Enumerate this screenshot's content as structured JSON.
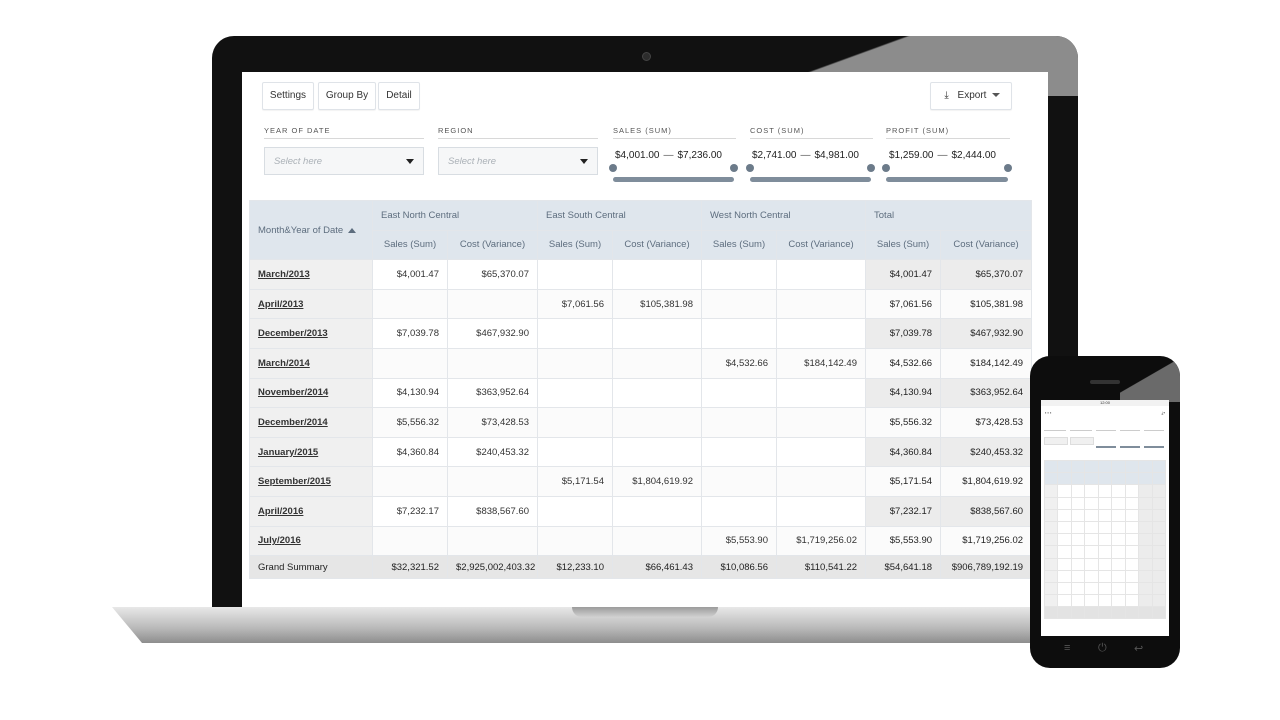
{
  "toolbar": {
    "settings": "Settings",
    "group_by": "Group By",
    "detail": "Detail",
    "export": "Export"
  },
  "filters": {
    "year": {
      "label": "YEAR OF DATE",
      "placeholder": "Select here"
    },
    "region": {
      "label": "REGION",
      "placeholder": "Select here"
    },
    "sales": {
      "label": "SALES (SUM)",
      "min": "$4,001.00",
      "max": "$7,236.00"
    },
    "cost": {
      "label": "COST (SUM)",
      "min": "$2,741.00",
      "max": "$4,981.00"
    },
    "profit": {
      "label": "PROFIT (SUM)",
      "min": "$1,259.00",
      "max": "$2,444.00"
    },
    "dash": "—"
  },
  "table": {
    "row_header": "Month&Year of Date",
    "regions": [
      "East North Central",
      "East South Central",
      "West North Central",
      "Total"
    ],
    "measures": [
      "Sales (Sum)",
      "Cost (Variance)",
      "Sales (Sum)",
      "Cost (Variance)",
      "Sales (Sum)",
      "Cost (Variance)",
      "Sales (Sum)",
      "Cost (Variance)"
    ],
    "rows": [
      {
        "label": "March/2013",
        "cells": [
          "$4,001.47",
          "$65,370.07",
          "",
          "",
          "",
          "",
          "$4,001.47",
          "$65,370.07"
        ]
      },
      {
        "label": "April/2013",
        "cells": [
          "",
          "",
          "$7,061.56",
          "$105,381.98",
          "",
          "",
          "$7,061.56",
          "$105,381.98"
        ]
      },
      {
        "label": "December/2013",
        "cells": [
          "$7,039.78",
          "$467,932.90",
          "",
          "",
          "",
          "",
          "$7,039.78",
          "$467,932.90"
        ]
      },
      {
        "label": "March/2014",
        "cells": [
          "",
          "",
          "",
          "",
          "$4,532.66",
          "$184,142.49",
          "$4,532.66",
          "$184,142.49"
        ]
      },
      {
        "label": "November/2014",
        "cells": [
          "$4,130.94",
          "$363,952.64",
          "",
          "",
          "",
          "",
          "$4,130.94",
          "$363,952.64"
        ]
      },
      {
        "label": "December/2014",
        "cells": [
          "$5,556.32",
          "$73,428.53",
          "",
          "",
          "",
          "",
          "$5,556.32",
          "$73,428.53"
        ]
      },
      {
        "label": "January/2015",
        "cells": [
          "$4,360.84",
          "$240,453.32",
          "",
          "",
          "",
          "",
          "$4,360.84",
          "$240,453.32"
        ]
      },
      {
        "label": "September/2015",
        "cells": [
          "",
          "",
          "$5,171.54",
          "$1,804,619.92",
          "",
          "",
          "$5,171.54",
          "$1,804,619.92"
        ]
      },
      {
        "label": "April/2016",
        "cells": [
          "$7,232.17",
          "$838,567.60",
          "",
          "",
          "",
          "",
          "$7,232.17",
          "$838,567.60"
        ]
      },
      {
        "label": "July/2016",
        "cells": [
          "",
          "",
          "",
          "",
          "$5,553.90",
          "$1,719,256.02",
          "$5,553.90",
          "$1,719,256.02"
        ]
      }
    ],
    "grand": {
      "label": "Grand Summary",
      "cells": [
        "$32,321.52",
        "$2,925,002,403.32",
        "$12,233.10",
        "$66,461.43",
        "$10,086.56",
        "$110,541.22",
        "$54,641.18",
        "$906,789,192.19"
      ]
    }
  },
  "phone": {
    "time": "12:00"
  }
}
